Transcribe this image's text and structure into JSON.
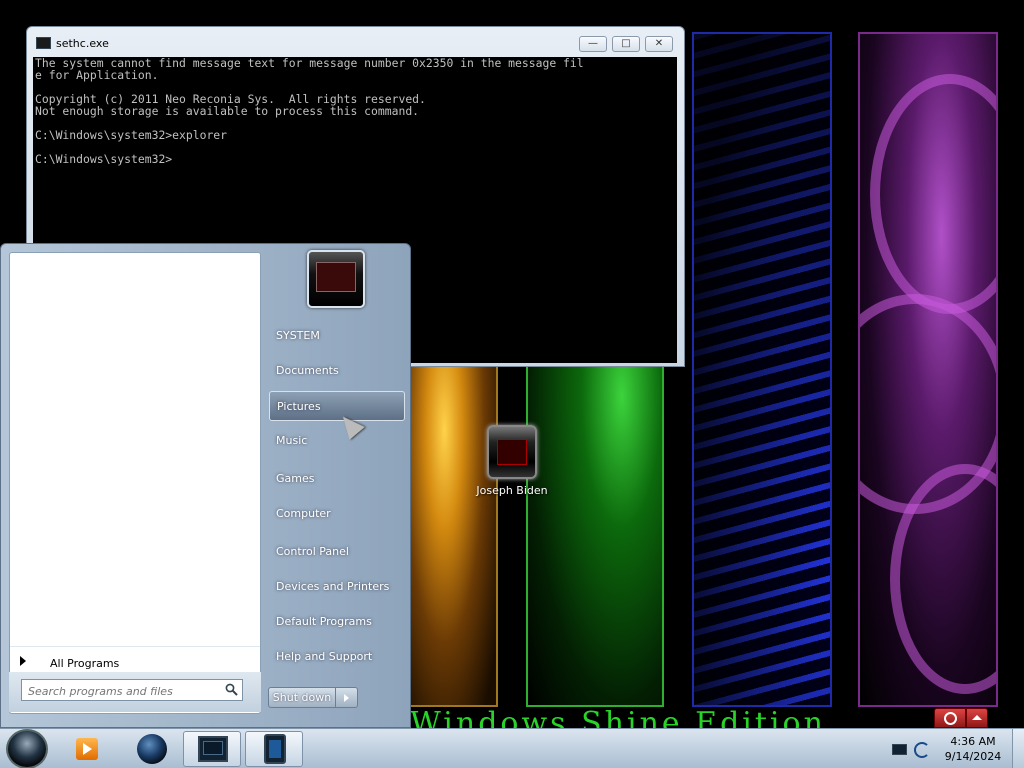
{
  "console": {
    "title": "sethc.exe",
    "controls": {
      "minimize": "—",
      "maximize": "□",
      "close": "✕"
    },
    "lines": [
      "The system cannot find message text for message number 0x2350 in the message fil",
      "e for Application.",
      "",
      "Copyright (c) 2011 Neo Reconia Sys.  All rights reserved.",
      "Not enough storage is available to process this command.",
      "",
      "C:\\Windows\\system32>explorer",
      "",
      "C:\\Windows\\system32>"
    ]
  },
  "desktop": {
    "icon_label": "Joseph Biden",
    "wallpaper_text": "Windows Shine Edition",
    "colors": {
      "orange": "#d48a10",
      "green": "#2fae2f",
      "blue": "#2a3cff",
      "purple": "#b050c8",
      "wallpaper_text": "#28d428"
    }
  },
  "start_menu": {
    "all_programs": "All Programs",
    "search_placeholder": "Search programs and files",
    "right_items": [
      {
        "label": "SYSTEM"
      },
      {
        "label": "Documents"
      },
      {
        "label": "Pictures",
        "highlighted": true
      },
      {
        "label": "Music"
      },
      {
        "label": "Games"
      },
      {
        "label": "Computer"
      },
      {
        "label": "Control Panel"
      },
      {
        "label": "Devices and Printers"
      },
      {
        "label": "Default Programs"
      },
      {
        "label": "Help and Support"
      }
    ],
    "shutdown_label": "Shut down"
  },
  "taskbar": {
    "pinned": [
      "start-orb",
      "media-player-icon",
      "globe-icon",
      "console-icon",
      "tablet-icon"
    ],
    "active_item": "console-icon",
    "clock_time": "4:36 AM",
    "clock_date": "9/14/2024"
  }
}
